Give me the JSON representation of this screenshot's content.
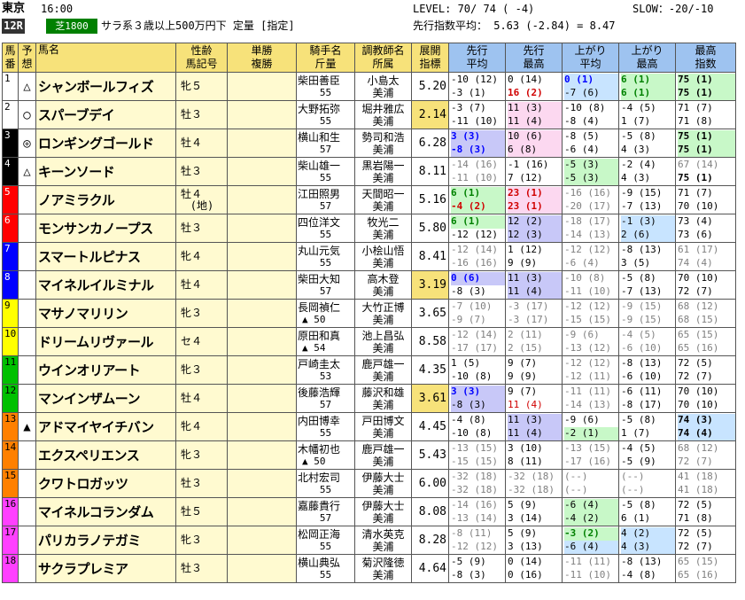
{
  "header": {
    "venue": "東京",
    "time": "16:00",
    "level": "LEVEL:  70/ 74 ( -4)",
    "slow": "SLOW：-20/-10",
    "race": "12R",
    "course": "芝1800",
    "conditions": "サラ系３歳以上500万円下 定量 [指定]",
    "pace_avg": "先行指数平均： 5.63  (-2.84) =  8.47"
  },
  "columns": {
    "num": [
      "馬",
      "番"
    ],
    "mark": [
      "予",
      "想"
    ],
    "name": "馬名",
    "sex": [
      "性齢",
      "馬記号"
    ],
    "win": [
      "単勝",
      "複勝"
    ],
    "jockey": [
      "騎手名",
      "斤量"
    ],
    "trainer": [
      "調教師名",
      "所属"
    ],
    "dev": [
      "展開",
      "指標"
    ],
    "e_avg": [
      "先行",
      "平均"
    ],
    "e_max": [
      "先行",
      "最高"
    ],
    "l_avg": [
      "上がり",
      "平均"
    ],
    "l_max": [
      "上がり",
      "最高"
    ],
    "best": [
      "最高",
      "指数"
    ]
  },
  "colors": {
    "gate1": "#ffffff",
    "gate2": "#000000",
    "gate3": "#ff0000",
    "gate4": "#0000ff",
    "gate5": "#ffff00",
    "gate6": "#00c000",
    "gate7": "#ff8000",
    "gate8": "#ff40ff"
  },
  "horses": [
    {
      "no": "1",
      "mark": "△",
      "name": "シャンボールフィズ",
      "sex": "牝５",
      "sex2": "",
      "jockey": "柴田善臣",
      "weight": "55",
      "trainer": "小島太",
      "affil": "美浦",
      "dev": "5.20",
      "e_avg": [
        "-10 (12)",
        "-3 (1)"
      ],
      "e_max": [
        "0 (14)",
        "16 (2)"
      ],
      "l_avg": [
        "0 (1)",
        "-7 (6)"
      ],
      "l_max": [
        "6 (1)",
        "6 (1)"
      ],
      "best": [
        "75 (1)",
        "75 (1)"
      ]
    },
    {
      "no": "2",
      "mark": "○",
      "name": "スパーブデイ",
      "sex": "牡３",
      "sex2": "",
      "jockey": "大野拓弥",
      "weight": "55",
      "trainer": "堀井雅広",
      "affil": "美浦",
      "dev": "2.14",
      "e_avg": [
        "-3 (7)",
        "-11 (10)"
      ],
      "e_max": [
        "11 (3)",
        "11 (4)"
      ],
      "l_avg": [
        "-10 (8)",
        "-8 (4)"
      ],
      "l_max": [
        "-4 (5)",
        "1 (7)"
      ],
      "best": [
        "71 (7)",
        "71 (8)"
      ]
    },
    {
      "no": "3",
      "mark": "◎",
      "name": "ロンギングゴールド",
      "sex": "牡４",
      "sex2": "",
      "jockey": "横山和生",
      "weight": "57",
      "trainer": "勢司和浩",
      "affil": "美浦",
      "dev": "6.28",
      "e_avg": [
        "3 (3)",
        "-8 (3)"
      ],
      "e_max": [
        "10 (6)",
        "6 (8)"
      ],
      "l_avg": [
        "-8 (5)",
        "-6 (4)"
      ],
      "l_max": [
        "-5 (8)",
        "4 (3)"
      ],
      "best": [
        "75 (1)",
        "75 (1)"
      ]
    },
    {
      "no": "4",
      "mark": "△",
      "name": "キーンソード",
      "sex": "牡３",
      "sex2": "",
      "jockey": "柴山雄一",
      "weight": "55",
      "trainer": "黒岩陽一",
      "affil": "美浦",
      "dev": "8.11",
      "e_avg": [
        "-14 (16)",
        "-11 (10)"
      ],
      "e_max": [
        "-1 (16)",
        "7 (12)"
      ],
      "l_avg": [
        "-5 (3)",
        "-5 (3)"
      ],
      "l_max": [
        "-2 (4)",
        "4 (3)"
      ],
      "best": [
        "67 (14)",
        "75 (1)"
      ]
    },
    {
      "no": "5",
      "mark": "",
      "name": "ノアミラクル",
      "sex": "牡４",
      "sex2": "(地)",
      "jockey": "江田照男",
      "weight": "57",
      "trainer": "天間昭一",
      "affil": "美浦",
      "dev": "5.16",
      "e_avg": [
        "6 (1)",
        "-4 (2)"
      ],
      "e_max": [
        "23 (1)",
        "23 (1)"
      ],
      "l_avg": [
        "-16 (16)",
        "-20 (17)"
      ],
      "l_max": [
        "-9 (15)",
        "-7 (13)"
      ],
      "best": [
        "71 (7)",
        "70 (10)"
      ]
    },
    {
      "no": "6",
      "mark": "",
      "name": "モンサンカノープス",
      "sex": "牡３",
      "sex2": "",
      "jockey": "四位洋文",
      "weight": "55",
      "trainer": "牧光二",
      "affil": "美浦",
      "dev": "5.80",
      "e_avg": [
        "6 (1)",
        "-12 (12)"
      ],
      "e_max": [
        "12 (2)",
        "12 (3)"
      ],
      "l_avg": [
        "-18 (17)",
        "-14 (13)"
      ],
      "l_max": [
        "-1 (3)",
        "2 (6)"
      ],
      "best": [
        "73 (4)",
        "73 (6)"
      ]
    },
    {
      "no": "7",
      "mark": "",
      "name": "スマートルピナス",
      "sex": "牝４",
      "sex2": "",
      "jockey": "丸山元気",
      "weight": "55",
      "trainer": "小桧山悟",
      "affil": "美浦",
      "dev": "8.41",
      "e_avg": [
        "-12 (14)",
        "-16 (16)"
      ],
      "e_max": [
        "1 (12)",
        "9 (9)"
      ],
      "l_avg": [
        "-12 (12)",
        "-6 (4)"
      ],
      "l_max": [
        "-8 (13)",
        "3 (5)"
      ],
      "best": [
        "61 (17)",
        "74 (4)"
      ]
    },
    {
      "no": "8",
      "mark": "",
      "name": "マイネルイルミナル",
      "sex": "牡４",
      "sex2": "",
      "jockey": "柴田大知",
      "weight": "57",
      "trainer": "高木登",
      "affil": "美浦",
      "dev": "3.19",
      "e_avg": [
        "0 (6)",
        "-8 (3)"
      ],
      "e_max": [
        "11 (3)",
        "11 (4)"
      ],
      "l_avg": [
        "-10 (8)",
        "-11 (10)"
      ],
      "l_max": [
        "-5 (8)",
        "-7 (13)"
      ],
      "best": [
        "70 (10)",
        "72 (7)"
      ]
    },
    {
      "no": "9",
      "mark": "",
      "name": "マサノマリリン",
      "sex": "牝３",
      "sex2": "",
      "jockey": "長岡禎仁",
      "weight": "▲ 50",
      "trainer": "大竹正博",
      "affil": "美浦",
      "dev": "3.65",
      "e_avg": [
        "-7 (10)",
        "-9 (7)"
      ],
      "e_max": [
        "-3 (17)",
        "-3 (17)"
      ],
      "l_avg": [
        "-12 (12)",
        "-15 (15)"
      ],
      "l_max": [
        "-9 (15)",
        "-9 (15)"
      ],
      "best": [
        "68 (12)",
        "68 (15)"
      ]
    },
    {
      "no": "10",
      "mark": "",
      "name": "ドリームリヴァール",
      "sex": "セ４",
      "sex2": "",
      "jockey": "原田和真",
      "weight": "▲ 54",
      "trainer": "池上昌弘",
      "affil": "美浦",
      "dev": "8.58",
      "e_avg": [
        "-12 (14)",
        "-17 (17)"
      ],
      "e_max": [
        "2 (11)",
        "2 (15)"
      ],
      "l_avg": [
        "-9 (6)",
        "-13 (12)"
      ],
      "l_max": [
        "-4 (5)",
        "-6 (10)"
      ],
      "best": [
        "65 (15)",
        "65 (16)"
      ]
    },
    {
      "no": "11",
      "mark": "",
      "name": "ウインオリアート",
      "sex": "牝３",
      "sex2": "",
      "jockey": "戸崎圭太",
      "weight": "53",
      "trainer": "鹿戸雄一",
      "affil": "美浦",
      "dev": "4.35",
      "e_avg": [
        "1 (5)",
        "-10 (8)"
      ],
      "e_max": [
        "9 (7)",
        "9 (9)"
      ],
      "l_avg": [
        "-12 (12)",
        "-12 (11)"
      ],
      "l_max": [
        "-8 (13)",
        "-6 (10)"
      ],
      "best": [
        "72 (5)",
        "72 (7)"
      ]
    },
    {
      "no": "12",
      "mark": "",
      "name": "マンインザムーン",
      "sex": "牡４",
      "sex2": "",
      "jockey": "後藤浩輝",
      "weight": "57",
      "trainer": "藤沢和雄",
      "affil": "美浦",
      "dev": "3.61",
      "e_avg": [
        "3 (3)",
        "-8 (3)"
      ],
      "e_max": [
        "9 (7)",
        "11 (4)"
      ],
      "l_avg": [
        "-11 (11)",
        "-14 (13)"
      ],
      "l_max": [
        "-6 (11)",
        "-8 (17)"
      ],
      "best": [
        "70 (10)",
        "70 (10)"
      ]
    },
    {
      "no": "13",
      "mark": "▲",
      "name": "アドマイヤイチバン",
      "sex": "牝４",
      "sex2": "",
      "jockey": "内田博幸",
      "weight": "55",
      "trainer": "戸田博文",
      "affil": "美浦",
      "dev": "4.45",
      "e_avg": [
        "-4 (8)",
        "-10 (8)"
      ],
      "e_max": [
        "11 (3)",
        "11 (4)"
      ],
      "l_avg": [
        "-9 (6)",
        "-2 (1)"
      ],
      "l_max": [
        "-5 (8)",
        "1 (7)"
      ],
      "best": [
        "74 (3)",
        "74 (4)"
      ]
    },
    {
      "no": "14",
      "mark": "",
      "name": "エクスペリエンス",
      "sex": "牝３",
      "sex2": "",
      "jockey": "木幡初也",
      "weight": "▲ 50",
      "trainer": "鹿戸雄一",
      "affil": "美浦",
      "dev": "5.43",
      "e_avg": [
        "-13 (15)",
        "-15 (15)"
      ],
      "e_max": [
        "3 (10)",
        "8 (11)"
      ],
      "l_avg": [
        "-13 (15)",
        "-17 (16)"
      ],
      "l_max": [
        "-4 (5)",
        "-5 (9)"
      ],
      "best": [
        "68 (12)",
        "72 (7)"
      ]
    },
    {
      "no": "15",
      "mark": "",
      "name": "クワトロガッツ",
      "sex": "牡３",
      "sex2": "",
      "jockey": "北村宏司",
      "weight": "55",
      "trainer": "伊藤大士",
      "affil": "美浦",
      "dev": "6.00",
      "e_avg": [
        "-32 (18)",
        "-32 (18)"
      ],
      "e_max": [
        "-32 (18)",
        "-32 (18)"
      ],
      "l_avg": [
        "(--)",
        "(--)"
      ],
      "l_max": [
        "(--)",
        "(--)"
      ],
      "best": [
        "41 (18)",
        "41 (18)"
      ]
    },
    {
      "no": "16",
      "mark": "",
      "name": "マイネルコランダム",
      "sex": "牡５",
      "sex2": "",
      "jockey": "嘉藤貴行",
      "weight": "57",
      "trainer": "伊藤大士",
      "affil": "美浦",
      "dev": "8.08",
      "e_avg": [
        "-14 (16)",
        "-13 (14)"
      ],
      "e_max": [
        "5 (9)",
        "3 (14)"
      ],
      "l_avg": [
        "-6 (4)",
        "-4 (2)"
      ],
      "l_max": [
        "-5 (8)",
        "6 (1)"
      ],
      "best": [
        "72 (5)",
        "71 (8)"
      ]
    },
    {
      "no": "17",
      "mark": "",
      "name": "パリカラノテガミ",
      "sex": "牝３",
      "sex2": "",
      "jockey": "松岡正海",
      "weight": "55",
      "trainer": "清水英克",
      "affil": "美浦",
      "dev": "8.28",
      "e_avg": [
        "-8 (11)",
        "-12 (12)"
      ],
      "e_max": [
        "5 (9)",
        "3 (13)"
      ],
      "l_avg": [
        "-3 (2)",
        "-6 (4)"
      ],
      "l_max": [
        "4 (2)",
        "4 (3)"
      ],
      "best": [
        "72 (5)",
        "72 (7)"
      ]
    },
    {
      "no": "18",
      "mark": "",
      "name": "サクラプレミア",
      "sex": "牡３",
      "sex2": "",
      "jockey": "横山典弘",
      "weight": "55",
      "trainer": "菊沢隆徳",
      "affil": "美浦",
      "dev": "4.64",
      "e_avg": [
        "-5 (9)",
        "-8 (3)"
      ],
      "e_max": [
        "0 (14)",
        "0 (16)"
      ],
      "l_avg": [
        "-11 (11)",
        "-11 (10)"
      ],
      "l_max": [
        "-8 (13)",
        "-4 (8)"
      ],
      "best": [
        "65 (15)",
        "65 (16)"
      ]
    }
  ]
}
